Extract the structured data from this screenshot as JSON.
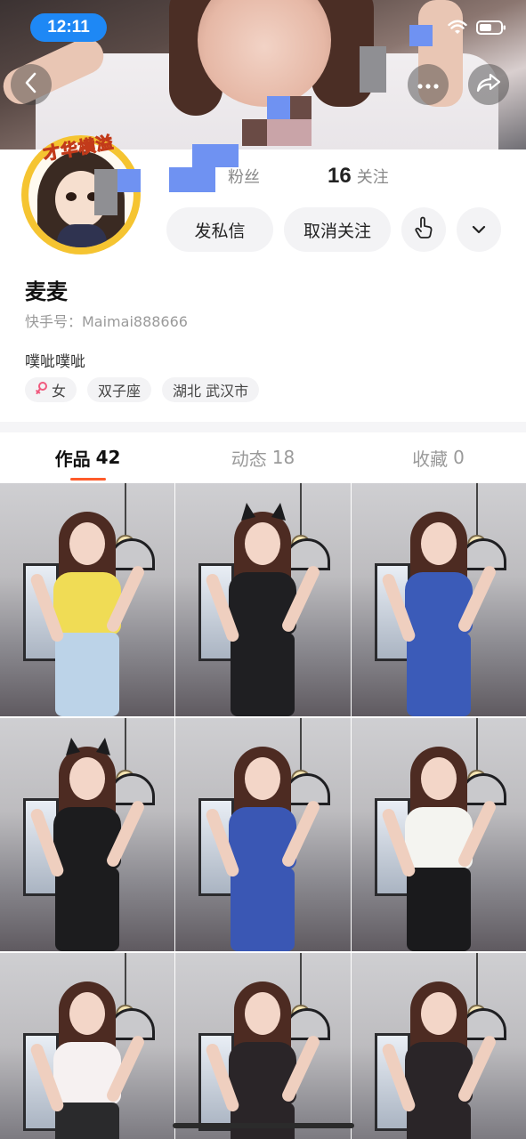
{
  "status_bar": {
    "time": "12:11"
  },
  "profile": {
    "badge_text": "才华横溢",
    "followers_label": "粉丝",
    "following_count": "16",
    "following_label": "关注",
    "name": "麦麦",
    "kuaishou_id": "快手号：Maimai888666",
    "bio": "噗呲噗呲",
    "tags": [
      "女",
      "双子座",
      "湖北 武汉市"
    ]
  },
  "actions": {
    "message_label": "发私信",
    "unfollow_label": "取消关注",
    "touch_icon": "pointing-hand-icon",
    "dropdown_icon": "chevron-down-icon"
  },
  "tabs": [
    {
      "label": "作品",
      "count": "42",
      "active": true
    },
    {
      "label": "动态",
      "count": "18",
      "active": false
    },
    {
      "label": "收藏",
      "count": "0",
      "active": false
    }
  ],
  "grid": {
    "tiles": [
      {
        "top_color": "#f0dc55",
        "bottom_color": "#bcd3e8",
        "ears": false
      },
      {
        "top_color": "#1f1f22",
        "bottom_color": "#1f1f22",
        "ears": true
      },
      {
        "top_color": "#3b5bb8",
        "bottom_color": "#3b5bb8",
        "ears": false
      },
      {
        "top_color": "#1c1c1e",
        "bottom_color": "#1c1c1e",
        "ears": true
      },
      {
        "top_color": "#3a57b4",
        "bottom_color": "#3a57b4",
        "ears": false
      },
      {
        "top_color": "#f4f4f0",
        "bottom_color": "#1a1a1c",
        "ears": false
      },
      {
        "top_color": "#f6f1f1",
        "bottom_color": "#2a2a2c",
        "ears": false
      },
      {
        "top_color": "#2a2528",
        "bottom_color": "#2a2528",
        "ears": false
      },
      {
        "top_color": "#2a2528",
        "bottom_color": "#2a2528",
        "ears": false
      }
    ]
  },
  "colors": {
    "accent": "#fe5b2b",
    "button_bg": "#f3f3f5",
    "status_pill": "#1e88f5"
  }
}
